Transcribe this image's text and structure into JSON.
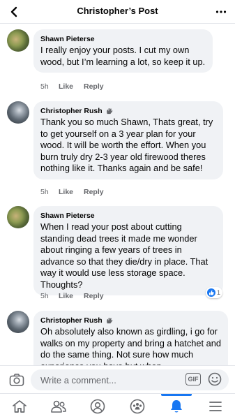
{
  "header": {
    "title": "Christopher’s Post"
  },
  "comments": [
    {
      "author": "Shawn Pieterse",
      "text": "I really enjoy your posts. I cut my own wood, but I’m learning a lot, so keep it up.",
      "time": "5h",
      "like": "Like",
      "reply": "Reply"
    },
    {
      "author": "Christopher Rush",
      "text": "Thank you so much Shawn, Thats great, try to get yourself on a 3 year plan for your wood. It will be worth the effort. When you burn truly dry 2-3 year old firewood theres nothing like it. Thanks again and be safe!",
      "time": "5h",
      "like": "Like",
      "reply": "Reply"
    },
    {
      "author": "Shawn Pieterse",
      "text": "When I read your post about cutting standing dead trees it made me wonder about ringing a few years of trees in advance so that they die/dry in place. That way it would use less storage space. Thoughts?",
      "time": "5h",
      "like": "Like",
      "reply": "Reply",
      "reaction_count": "1"
    },
    {
      "author": "Christopher Rush",
      "text": "Oh absolutely also known as girdling, i go for walks on my property and bring a hatchet and do the same thing. Not sure how much experience you have but when",
      "time": "",
      "like": "",
      "reply": ""
    }
  ],
  "composer": {
    "placeholder": "Write a comment...",
    "gif_label": "GIF"
  },
  "nav": [
    "home-icon",
    "friends-icon",
    "profile-icon",
    "groups-icon",
    "notifications-icon",
    "menu-icon"
  ],
  "colors": {
    "accent": "#1877f2",
    "bubble": "#f0f2f5",
    "secondary_text": "#65676b"
  }
}
